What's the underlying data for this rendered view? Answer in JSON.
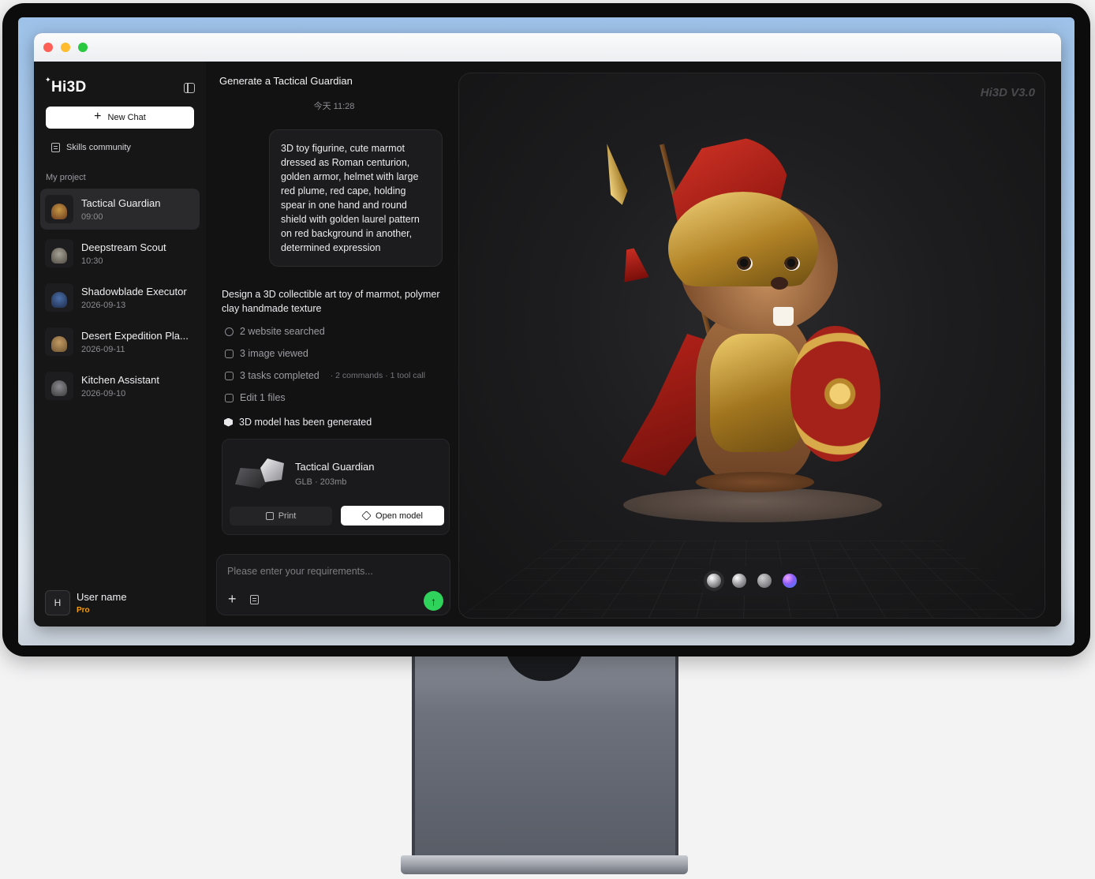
{
  "app": {
    "brand": "Hi3D",
    "new_chat_label": "New Chat",
    "skills_label": "Skills community",
    "section_label": "My project",
    "projects": [
      {
        "name": "Tactical Guardian",
        "time": "09:00",
        "active": true
      },
      {
        "name": "Deepstream Scout",
        "time": "10:30"
      },
      {
        "name": "Shadowblade Executor",
        "time": "2026-09-13"
      },
      {
        "name": "Desert Expedition Pla...",
        "time": "2026-09-11"
      },
      {
        "name": "Kitchen Assistant",
        "time": "2026-09-10"
      }
    ],
    "user": {
      "initial": "H",
      "name": "User name",
      "plan": "Pro"
    }
  },
  "chat": {
    "title": "Generate a Tactical Guardian",
    "time": "今天 11:28",
    "prompt": "3D toy figurine, cute marmot dressed as Roman centurion, golden armor, helmet with large red plume, red cape, holding spear in one hand and round shield with golden laurel pattern on red background in another, determined expression",
    "reply": "Design a 3D collectible art toy of marmot, polymer clay handmade texture",
    "steps": [
      {
        "label": "2 website searched",
        "sub": "",
        "icon": "globe-icon"
      },
      {
        "label": "3 image viewed",
        "sub": "",
        "icon": "image-icon"
      },
      {
        "label": "3 tasks completed",
        "sub": "· 2 commands · 1 tool call",
        "icon": "terminal-icon"
      },
      {
        "label": "Edit 1 files",
        "sub": "",
        "icon": "edit-icon"
      }
    ],
    "generated_label": "3D model has been generated",
    "model": {
      "name": "Tactical Guardian",
      "meta": "GLB · 203mb",
      "print_label": "Print",
      "open_label": "Open model"
    },
    "composer_placeholder": "Please enter your requirements..."
  },
  "viewer": {
    "watermark": "Hi3D V3.0",
    "materials": [
      "matte-sphere",
      "chrome-sphere",
      "clay-sphere",
      "gradient-sphere"
    ]
  },
  "colors": {
    "accent_send": "#2fd25a",
    "pro_badge": "#f59e0b",
    "window_bg": "#101011"
  }
}
